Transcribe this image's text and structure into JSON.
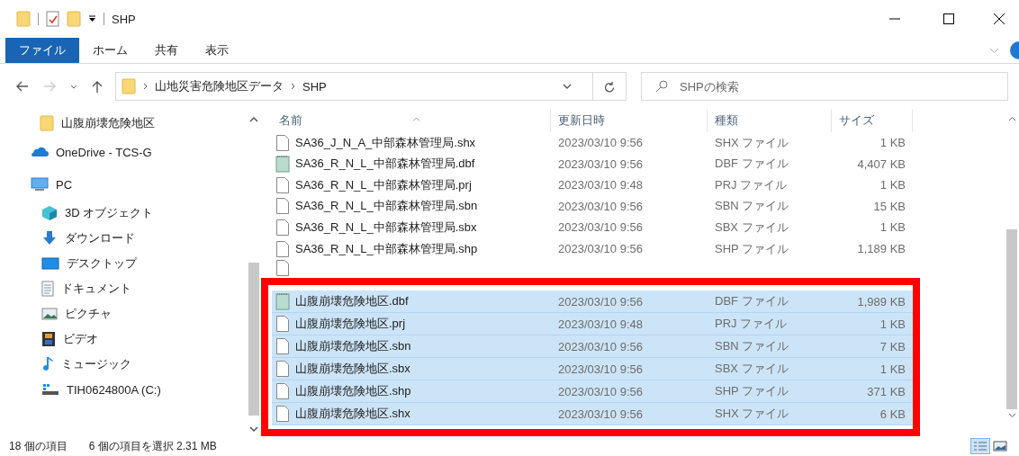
{
  "window": {
    "title": "SHP"
  },
  "ribbon_tabs": [
    {
      "label": "ファイル",
      "selected": true
    },
    {
      "label": "ホーム",
      "selected": false
    },
    {
      "label": "共有",
      "selected": false
    },
    {
      "label": "表示",
      "selected": false
    }
  ],
  "address": {
    "path": [
      "山地災害危険地区データ",
      "SHP"
    ]
  },
  "search": {
    "placeholder": "SHPの検索"
  },
  "sidebar": {
    "items": [
      {
        "label": "山腹崩壊危険地区",
        "kind": "folder"
      },
      {
        "label": "OneDrive - TCS-G",
        "kind": "cloud"
      },
      {
        "label": "PC",
        "kind": "pc",
        "children": [
          {
            "label": "3D オブジェクト",
            "kind": "cube"
          },
          {
            "label": "ダウンロード",
            "kind": "download"
          },
          {
            "label": "デスクトップ",
            "kind": "desktop"
          },
          {
            "label": "ドキュメント",
            "kind": "document"
          },
          {
            "label": "ピクチャ",
            "kind": "pictures"
          },
          {
            "label": "ビデオ",
            "kind": "video"
          },
          {
            "label": "ミュージック",
            "kind": "music"
          },
          {
            "label": "TIH0624800A (C:)",
            "kind": "drive"
          }
        ]
      }
    ]
  },
  "table": {
    "columns": [
      "名前",
      "更新日時",
      "種類",
      "サイズ"
    ],
    "rows": [
      {
        "name": "SA36_J_N_A_中部森林管理局.shx",
        "date": "2023/03/10 9:56",
        "type": "SHX ファイル",
        "size": "1 KB",
        "kind": "file",
        "selected": false
      },
      {
        "name": "SA36_R_N_L_中部森林管理局.dbf",
        "date": "2023/03/10 9:56",
        "type": "DBF ファイル",
        "size": "4,407 KB",
        "kind": "table",
        "selected": false
      },
      {
        "name": "SA36_R_N_L_中部森林管理局.prj",
        "date": "2023/03/10 9:48",
        "type": "PRJ ファイル",
        "size": "1 KB",
        "kind": "file",
        "selected": false
      },
      {
        "name": "SA36_R_N_L_中部森林管理局.sbn",
        "date": "2023/03/10 9:56",
        "type": "SBN ファイル",
        "size": "15 KB",
        "kind": "file",
        "selected": false
      },
      {
        "name": "SA36_R_N_L_中部森林管理局.sbx",
        "date": "2023/03/10 9:56",
        "type": "SBX ファイル",
        "size": "1 KB",
        "kind": "file",
        "selected": false
      },
      {
        "name": "SA36_R_N_L_中部森林管理局.shp",
        "date": "2023/03/10 9:56",
        "type": "SHP ファイル",
        "size": "1,189 KB",
        "kind": "file",
        "selected": false
      },
      {
        "name": "山腹崩壊危険地区.dbf",
        "date": "2023/03/10 9:56",
        "type": "DBF ファイル",
        "size": "1,989 KB",
        "kind": "table",
        "selected": true
      },
      {
        "name": "山腹崩壊危険地区.prj",
        "date": "2023/03/10 9:48",
        "type": "PRJ ファイル",
        "size": "1 KB",
        "kind": "file",
        "selected": true
      },
      {
        "name": "山腹崩壊危険地区.sbn",
        "date": "2023/03/10 9:56",
        "type": "SBN ファイル",
        "size": "7 KB",
        "kind": "file",
        "selected": true
      },
      {
        "name": "山腹崩壊危険地区.sbx",
        "date": "2023/03/10 9:56",
        "type": "SBX ファイル",
        "size": "1 KB",
        "kind": "file",
        "selected": true
      },
      {
        "name": "山腹崩壊危険地区.shp",
        "date": "2023/03/10 9:56",
        "type": "SHP ファイル",
        "size": "371 KB",
        "kind": "file",
        "selected": true
      },
      {
        "name": "山腹崩壊危険地区.shx",
        "date": "2023/03/10 9:56",
        "type": "SHX ファイル",
        "size": "6 KB",
        "kind": "file",
        "selected": true
      }
    ]
  },
  "status_bar": {
    "item_count": "18 個の項目",
    "selection": "6 個の項目を選択 2.31 MB"
  }
}
